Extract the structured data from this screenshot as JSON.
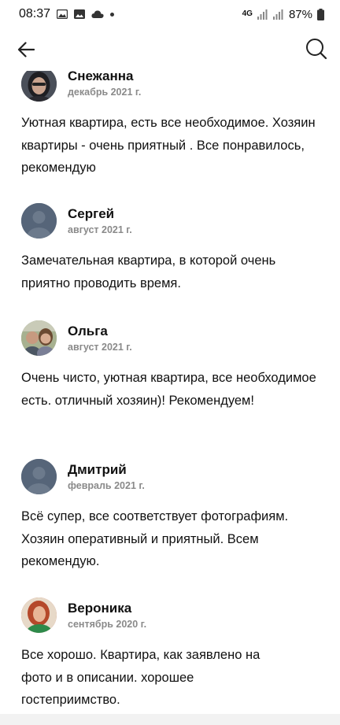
{
  "status_bar": {
    "time": "08:37",
    "signal": "4G",
    "battery": "87%"
  },
  "app_bar": {
    "back_icon": "arrow-left-icon",
    "search_icon": "search-icon"
  },
  "reviews": [
    {
      "name": "Снежанна",
      "date": "декабрь 2021 г.",
      "text": "Уютная квартира, есть все необходимое. Хозяин квартиры - очень приятный . Все понравилось, рекомендую",
      "avatar": "photo"
    },
    {
      "name": "Сергей",
      "date": "август 2021 г.",
      "text": "Замечательная квартира, в которой очень приятно проводить время.",
      "avatar": "default"
    },
    {
      "name": "Ольга",
      "date": "август 2021 г.",
      "text": "Очень чисто, уютная квартира, все необходимое есть. отличный хозяин)! Рекомендуем!",
      "avatar": "photo"
    },
    {
      "name": "Дмитрий",
      "date": "февраль 2021 г.",
      "text": "Всё супер, все соответствует фотографиям. Хозяин оперативный и приятный. Всем рекомендую.",
      "avatar": "default"
    },
    {
      "name": "Вероника",
      "date": "сентябрь 2020 г.",
      "text": "Все хорошо. Квартира, как заявлено на фото и в описании. хорошее гостеприимство.",
      "avatar": "photo"
    }
  ]
}
